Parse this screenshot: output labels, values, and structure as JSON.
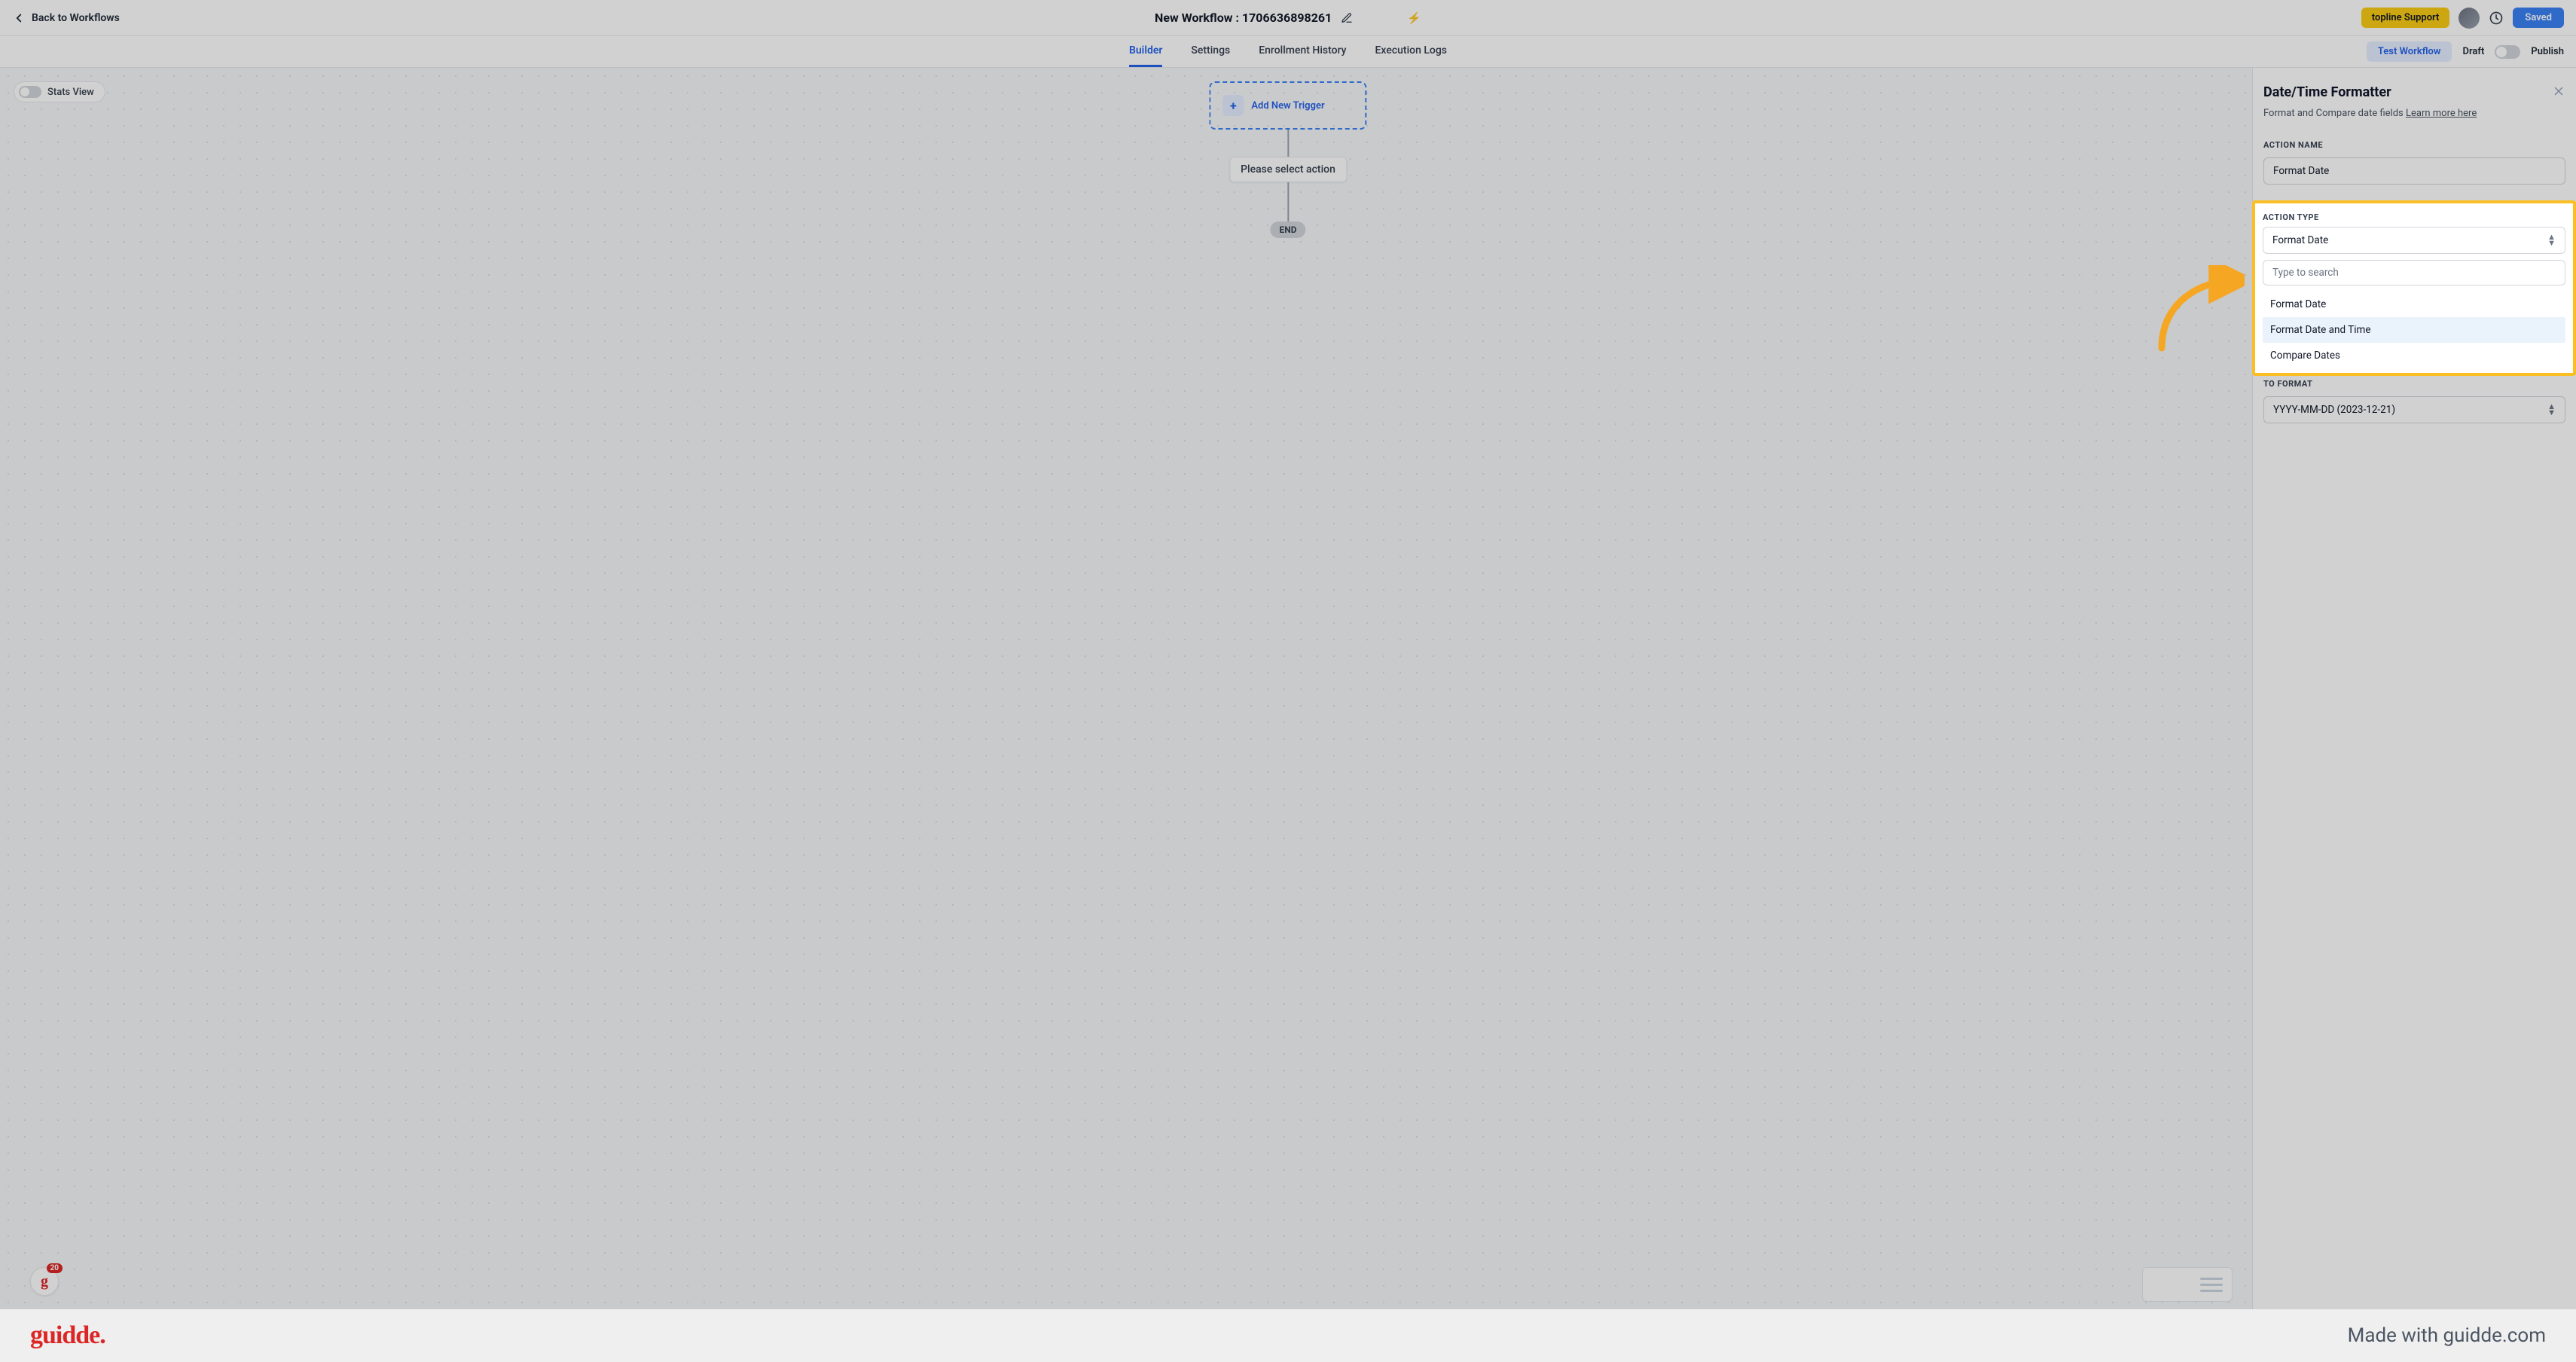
{
  "header": {
    "back_label": "Back to Workflows",
    "title": "New Workflow : 1706636898261",
    "support_label": "topline Support",
    "saved_label": "Saved"
  },
  "subnav": {
    "tabs": [
      "Builder",
      "Settings",
      "Enrollment History",
      "Execution Logs"
    ],
    "test_label": "Test Workflow",
    "draft_label": "Draft",
    "publish_label": "Publish"
  },
  "canvas": {
    "stats_label": "Stats View",
    "trigger_label": "Add New Trigger",
    "select_action_label": "Please select action",
    "end_label": "END",
    "fab_badge": "20"
  },
  "panel": {
    "title": "Date/Time Formatter",
    "subtitle": "Format and Compare date fields ",
    "learn_more": "Learn more here",
    "action_name_label": "ACTION NAME",
    "action_name_value": "Format Date",
    "action_type_label": "ACTION TYPE",
    "action_type_value": "Format Date",
    "to_format_label": "TO FORMAT",
    "to_format_value": "YYYY-MM-DD (2023-12-21)",
    "dropdown": {
      "search_placeholder": "Type to search",
      "options": [
        "Format Date",
        "Format Date and Time",
        "Compare Dates"
      ],
      "hover_index": 1
    }
  },
  "footer": {
    "logo": "guidde.",
    "right": "Made with guidde.com"
  }
}
